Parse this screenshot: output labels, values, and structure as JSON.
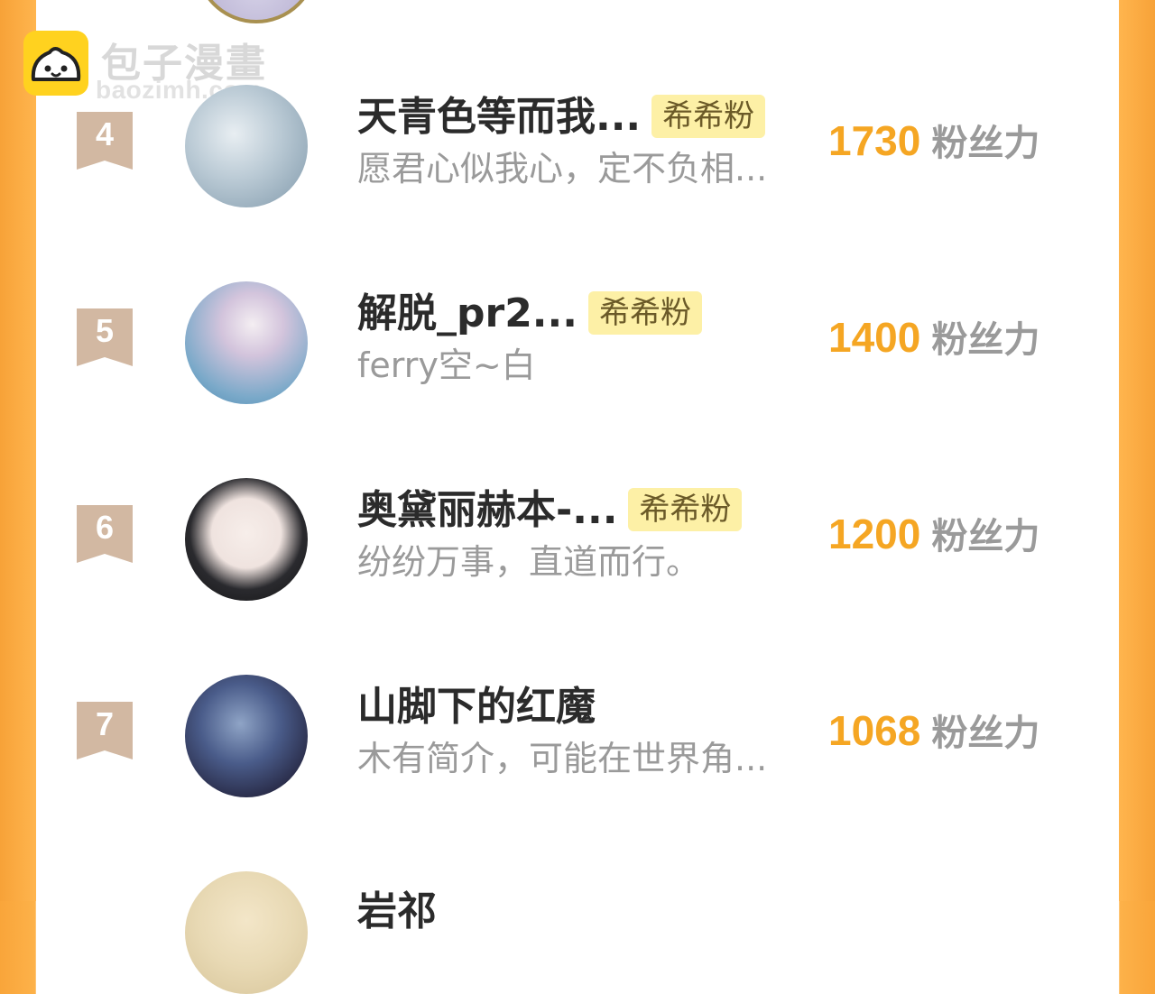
{
  "watermark": {
    "title": "包子漫畫",
    "url": "baozimh.com"
  },
  "ranking": [
    {
      "rank": "4",
      "name": "天青色等而我...",
      "badge": "希希粉",
      "bio": "愿君心似我心，定不负相...",
      "score": "1730",
      "unit": "粉丝力"
    },
    {
      "rank": "5",
      "name": "解脱_pr2...",
      "badge": "希希粉",
      "bio": "ferry空~白",
      "score": "1400",
      "unit": "粉丝力"
    },
    {
      "rank": "6",
      "name": "奥黛丽赫本-...",
      "badge": "希希粉",
      "bio": "纷纷万事，直道而行。",
      "score": "1200",
      "unit": "粉丝力"
    },
    {
      "rank": "7",
      "name": "山脚下的红魔",
      "badge": "",
      "bio": "木有简介，可能在世界角...",
      "score": "1068",
      "unit": "粉丝力"
    }
  ],
  "next_partial": {
    "name": "岩祁"
  },
  "colors": {
    "accent": "#f5a623",
    "badge_bg": "#fdf0a6",
    "frame": "#f9a53a"
  }
}
